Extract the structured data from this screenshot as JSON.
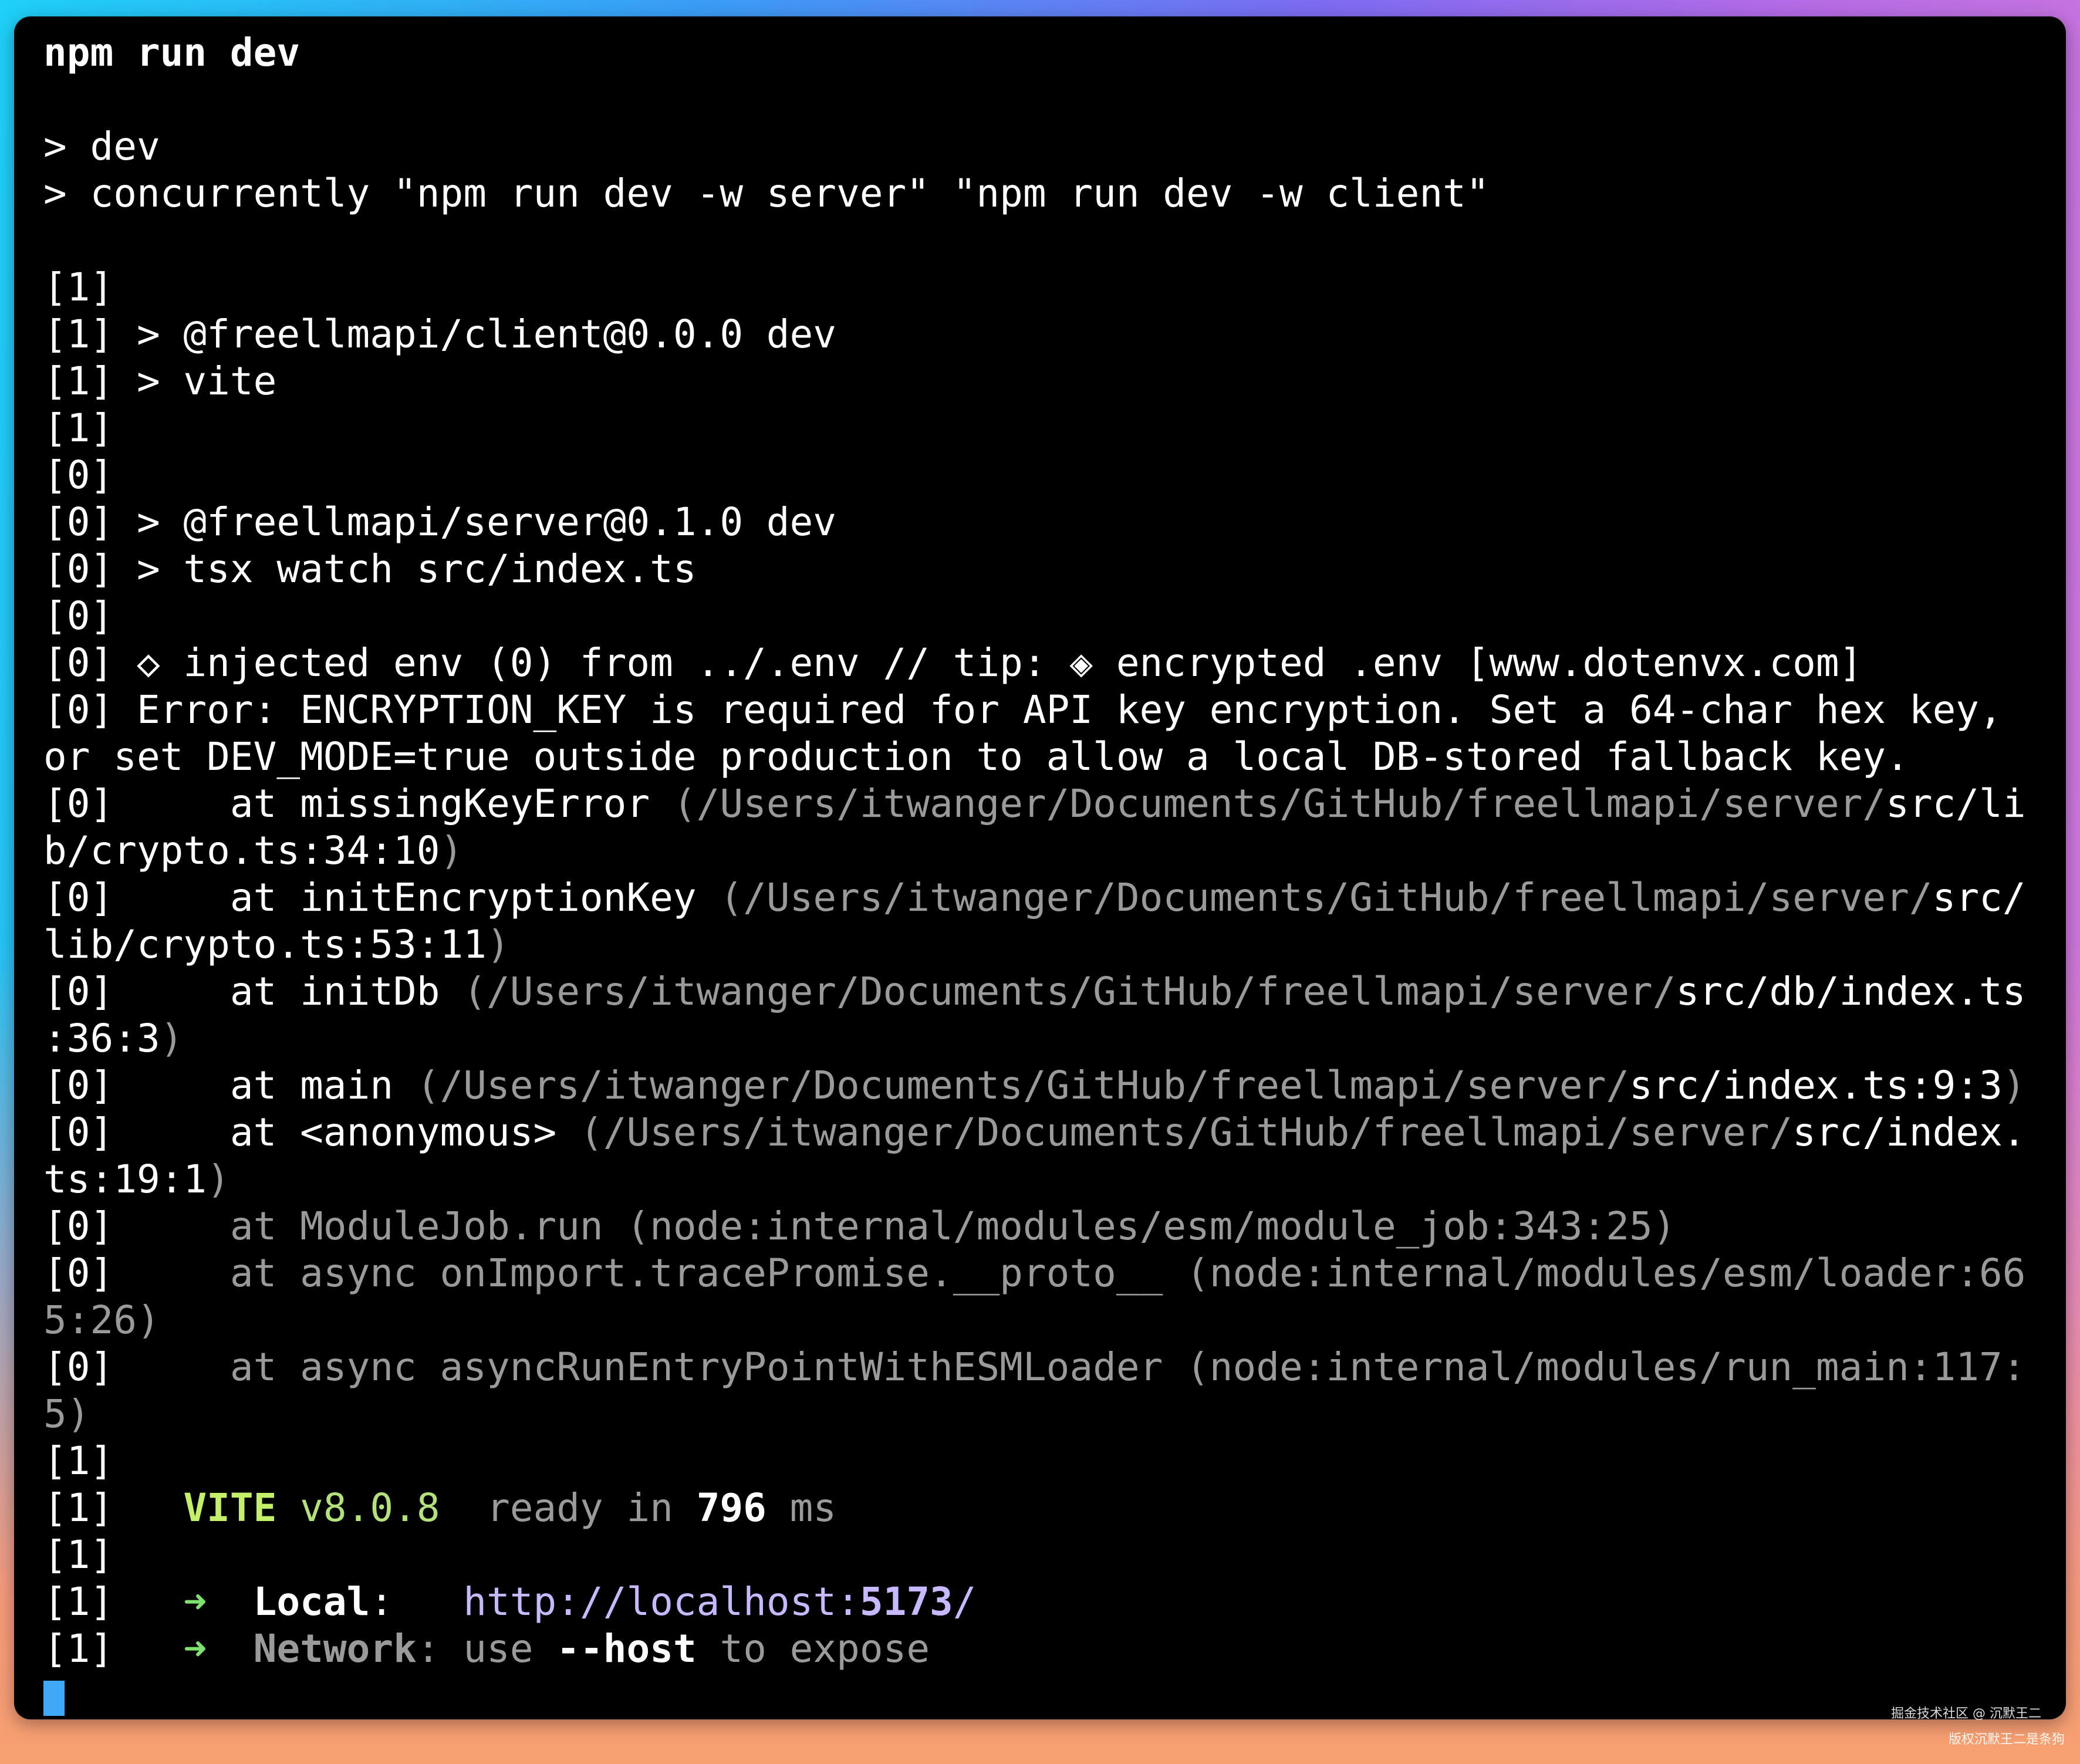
{
  "watermark": {
    "line1": "掘金技术社区 @ 沉默王二",
    "line2": "版权沉默王二是条狗"
  },
  "colors": {
    "cursor": "#3fa9f5",
    "vite_brand": "#c3f068",
    "arrow": "#7ee36c",
    "link": "#c7b8ff"
  },
  "terminal": {
    "command": "npm run dev",
    "lines": [
      "> dev",
      "> concurrently \"npm run dev -w server\" \"npm run dev -w client\"",
      "[1]",
      "[1] > @freellmapi/client@0.0.0 dev",
      "[1] > vite",
      "[1]",
      "[0]",
      "[0] > @freellmapi/server@0.1.0 dev",
      "[0] > tsx watch src/index.ts",
      "[0]",
      "[0] ◇ injected env (0) from ../.env // tip: ◈ encrypted .env [www.dotenvx.com]",
      "[0] Error: ENCRYPTION_KEY is required for API key encryption. Set a 64-char hex key,",
      "or set DEV_MODE=true outside production to allow a local DB-stored fallback key.",
      "[1]",
      "[1]",
      "[1]"
    ],
    "stack": [
      {
        "at": "at missingKeyError",
        "path": "(/Users/itwanger/Documents/GitHub/freellmapi/server/",
        "file": "src/li",
        "file2": "b/crypto.ts:34:10",
        "close": ")"
      },
      {
        "at": "at initEncryptionKey",
        "path": "(/Users/itwanger/Documents/GitHub/freellmapi/server/",
        "file": "src/",
        "file2": "lib/crypto.ts:53:11",
        "close": ")"
      },
      {
        "at": "at initDb",
        "path": "(/Users/itwanger/Documents/GitHub/freellmapi/server/",
        "file": "src/db/index.ts",
        "file2": ":36:3",
        "close": ")"
      },
      {
        "at": "at main",
        "path": "(/Users/itwanger/Documents/GitHub/freellmapi/server/",
        "file": "src/index.ts:9:3",
        "close": ")"
      },
      {
        "at": "at <anonymous>",
        "path": "(/Users/itwanger/Documents/GitHub/freellmapi/server/",
        "file": "src/index.",
        "file2": "ts:19:1",
        "close": ")"
      },
      {
        "text": "at ModuleJob.run (node:internal/modules/esm/module_job:343:25)"
      },
      {
        "text": "at async onImport.tracePromise.__proto__ (node:internal/modules/esm/loader:66",
        "text2": "5:26)"
      },
      {
        "text": "at async asyncRunEntryPointWithESMLoader (node:internal/modules/run_main:117:",
        "text2": "5)"
      }
    ],
    "prefix0": "[0]",
    "prefix1": "[1]",
    "vite": {
      "name": "VITE",
      "version": "v8.0.8",
      "ready": "ready in",
      "ms_value": "796",
      "ms_unit": "ms",
      "arrow": "➜",
      "local_label": "Local",
      "local_url_prefix": "http://localhost:",
      "local_port": "5173",
      "local_url_suffix": "/",
      "network_label": "Network",
      "network_use": "use",
      "network_flag": "--host",
      "network_suffix": "to expose",
      "colon": ":"
    }
  }
}
